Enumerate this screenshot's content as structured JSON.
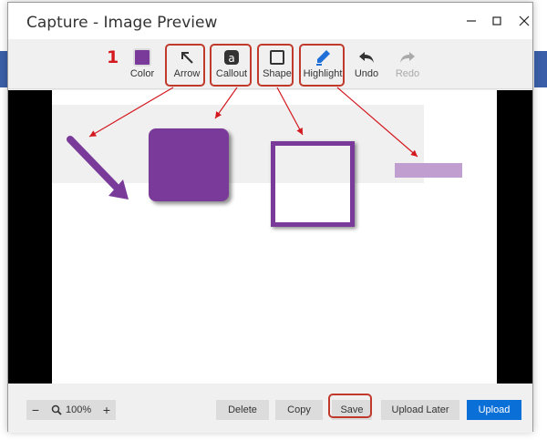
{
  "window": {
    "title": "Capture - Image Preview"
  },
  "annotation": {
    "step_number": "1"
  },
  "toolbar": {
    "color_label": "Color",
    "selected_color": "#7a3a9a",
    "arrow_label": "Arrow",
    "callout_label": "Callout",
    "shape_label": "Shape",
    "highlight_label": "Highlight",
    "undo_label": "Undo",
    "redo_label": "Redo"
  },
  "zoom": {
    "value": "100%",
    "minus": "−",
    "plus": "+"
  },
  "buttons": {
    "delete": "Delete",
    "copy": "Copy",
    "save": "Save",
    "upload_later": "Upload Later",
    "upload": "Upload"
  },
  "colors": {
    "accent": "#0a6fd6",
    "callout_red": "#c0392b",
    "purple": "#7a3a9a",
    "highlight": "#c09fd0"
  }
}
